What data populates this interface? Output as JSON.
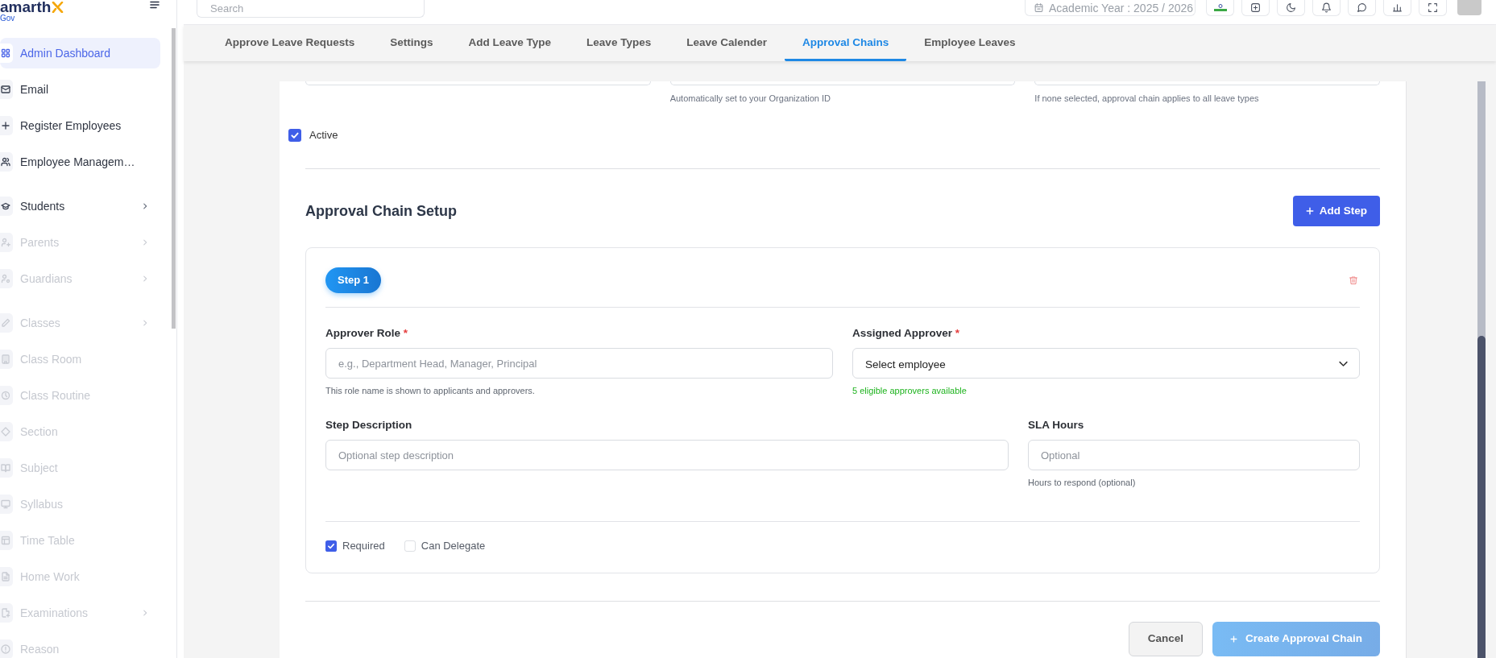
{
  "sidebar": {
    "logo": {
      "text": "amarth",
      "subtext": "Gov"
    },
    "groups": [
      {
        "items": [
          {
            "label": "Admin Dashboard",
            "selected": true,
            "disabled": false,
            "expandable": false
          },
          {
            "label": "Email",
            "selected": false,
            "disabled": false,
            "expandable": false
          },
          {
            "label": "Register Employees",
            "selected": false,
            "disabled": false,
            "expandable": false
          },
          {
            "label": "Employee Managem…",
            "selected": false,
            "disabled": false,
            "expandable": false
          }
        ]
      },
      {
        "items": [
          {
            "label": "Students",
            "selected": false,
            "disabled": false,
            "expandable": true
          },
          {
            "label": "Parents",
            "selected": false,
            "disabled": true,
            "expandable": true
          },
          {
            "label": "Guardians",
            "selected": false,
            "disabled": true,
            "expandable": true
          }
        ]
      },
      {
        "items": [
          {
            "label": "Classes",
            "selected": false,
            "disabled": true,
            "expandable": true
          },
          {
            "label": "Class Room",
            "selected": false,
            "disabled": true,
            "expandable": false
          },
          {
            "label": "Class Routine",
            "selected": false,
            "disabled": true,
            "expandable": false
          },
          {
            "label": "Section",
            "selected": false,
            "disabled": true,
            "expandable": false
          },
          {
            "label": "Subject",
            "selected": false,
            "disabled": true,
            "expandable": false
          },
          {
            "label": "Syllabus",
            "selected": false,
            "disabled": true,
            "expandable": false
          },
          {
            "label": "Time Table",
            "selected": false,
            "disabled": true,
            "expandable": false
          },
          {
            "label": "Home Work",
            "selected": false,
            "disabled": true,
            "expandable": false
          },
          {
            "label": "Examinations",
            "selected": false,
            "disabled": true,
            "expandable": true
          },
          {
            "label": "Reason",
            "selected": false,
            "disabled": true,
            "expandable": false
          }
        ]
      }
    ]
  },
  "header": {
    "search": {
      "placeholder": "Search"
    },
    "academic_year": "Academic Year : 2025 / 2026"
  },
  "tabs": [
    {
      "label": "Approve Leave Requests",
      "selected": false
    },
    {
      "label": "Settings",
      "selected": false
    },
    {
      "label": "Add Leave Type",
      "selected": false
    },
    {
      "label": "Leave Types",
      "selected": false
    },
    {
      "label": "Leave Calender",
      "selected": false
    },
    {
      "label": "Approval Chains",
      "selected": true
    },
    {
      "label": "Employee Leaves",
      "selected": false
    }
  ],
  "form": {
    "top_fields": [
      {
        "kind": "input"
      },
      {
        "kind": "input",
        "hint": "Automatically set to your Organization ID"
      },
      {
        "kind": "input",
        "hint": "If none selected, approval chain applies to all leave types"
      }
    ],
    "active": {
      "label": "Active",
      "checked": true
    },
    "section_title": "Approval Chain Setup",
    "add_step_button": {
      "label": "Add Step"
    },
    "steps": [
      {
        "badge": "Step 1",
        "rows": [
          {
            "fields": [
              {
                "label": "Approver Role",
                "required_mark": "*",
                "kind": "input",
                "placeholder": "e.g., Department Head, Manager, Principal",
                "hint": {
                  "text": "This role name is shown to applicants and approvers.",
                  "kind": "note"
                }
              },
              {
                "label": "Assigned Approver",
                "required_mark": "*",
                "kind": "select",
                "value": "Select employee",
                "hint": {
                  "text": "5 eligible approvers available",
                  "kind": "success"
                }
              }
            ]
          },
          {
            "fields": [
              {
                "label": "Step Description",
                "kind": "input",
                "placeholder": "Optional step description"
              },
              {
                "label": "SLA Hours",
                "kind": "input",
                "placeholder": "Optional",
                "hint": {
                  "text": "Hours to respond (optional)",
                  "kind": "note"
                }
              }
            ]
          }
        ],
        "options": [
          {
            "label": "Required",
            "checked": true
          },
          {
            "label": "Can Delegate",
            "checked": false
          }
        ]
      }
    ],
    "actions": [
      {
        "label": "Cancel",
        "kind": "secondary",
        "disabled": false
      },
      {
        "label": "Create Approval Chain",
        "kind": "primary",
        "disabled": true
      }
    ]
  }
}
